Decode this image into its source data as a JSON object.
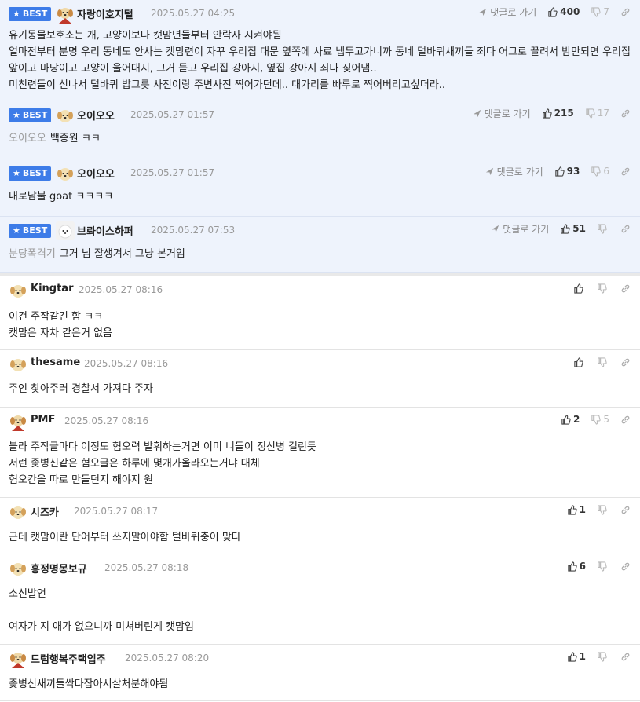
{
  "reply_label": "댓글로 가기",
  "best_label": "BEST",
  "best_comments": [
    {
      "nick": "자랑이호지털",
      "date": "2025.05.27 04:25",
      "likes": "400",
      "dislikes": "7",
      "mention": "",
      "text": "유기동물보호소는 개, 고양이보다 캣맘년들부터 안락사 시켜야됨\n얼마전부터 분명 우리 동네도 안사는 캣맘련이 자꾸 우리집 대문 옆쪽에 사료 냅두고가니까 동네 털바퀴새끼들 죄다 어그로 끌려서 밤만되면 우리집 앞이고 마당이고 고양이 울어대지, 그거 듣고 우리집 강아지, 옆집 강아지 죄다 짖어댐..\n미친련들이 신나서 털바퀴 밥그릇 사진이랑 주변사진 찍어가던데.. 대가리를 빠루로 찍어버리고싶더라.."
    },
    {
      "nick": "오이오오",
      "date": "2025.05.27 01:57",
      "likes": "215",
      "dislikes": "17",
      "mention": "오이오오",
      "text": "백종원 ㅋㅋ"
    },
    {
      "nick": "오이오오",
      "date": "2025.05.27 01:57",
      "likes": "93",
      "dislikes": "6",
      "mention": "",
      "text": "내로남불 goat ㅋㅋㅋㅋ"
    },
    {
      "nick": "브롸이스하퍼",
      "date": "2025.05.27 07:53",
      "likes": "51",
      "dislikes": "",
      "mention": "분당폭격기",
      "text": "그거 님 잘생겨서 그냥 본거임"
    }
  ],
  "comments": [
    {
      "nick": "Kingtar",
      "date": "2025.05.27 08:16",
      "likes": "",
      "dislikes": "",
      "text": "이건 주작같긴 함 ㅋㅋ\n캣맘은 자차 같은거 없음"
    },
    {
      "nick": "thesame",
      "date": "2025.05.27 08:16",
      "likes": "",
      "dislikes": "",
      "text": "주인 찾아주러 경찰서 가져다 주자"
    },
    {
      "nick": "PMF",
      "date": "2025.05.27 08:16",
      "likes": "2",
      "dislikes": "5",
      "text": "블라 주작글마다 이정도 혐오력 발휘하는거면 이미 니들이 정신병 걸린듯\n저런 좆병신같은 혐오글은 하루에 몇개가올라오는거냐 대체\n혐오칸을 따로 만들던지 해야지 원"
    },
    {
      "nick": "시즈카",
      "date": "2025.05.27 08:17",
      "likes": "1",
      "dislikes": "",
      "text": "근데 캣맘이란 단어부터 쓰지말아야함 털바퀴충이 맞다"
    },
    {
      "nick": "홍정명몽보규",
      "date": "2025.05.27 08:18",
      "likes": "6",
      "dislikes": "",
      "text": "소신발언\n\n여자가 지 애가 없으니까 미쳐버린게 캣맘임"
    },
    {
      "nick": "드럼행복주택입주",
      "date": "2025.05.27 08:20",
      "likes": "1",
      "dislikes": "",
      "text": "좆병신새끼들싹다잡아서살처분해야됨"
    }
  ]
}
